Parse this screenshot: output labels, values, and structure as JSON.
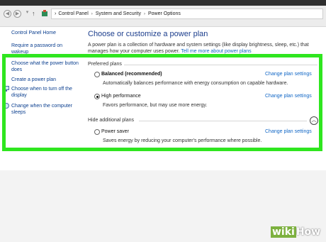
{
  "address_bar": {
    "crumbs": [
      "Control Panel",
      "System and Security",
      "Power Options"
    ],
    "separator": "›"
  },
  "left_nav": {
    "home": "Control Panel Home",
    "items": [
      "Require a password on wakeup",
      "Choose what the power button does",
      "Create a power plan",
      "Choose when to turn off the display",
      "Change when the computer sleeps"
    ]
  },
  "main": {
    "title": "Choose or customize a power plan",
    "intro_text": "A power plan is a collection of hardware and system settings (like display brightness, sleep, etc.) that manages how your computer uses power.",
    "intro_link": "Tell me more about power plans",
    "preferred_label": "Preferred plans",
    "hide_label": "Hide additional plans",
    "plans": [
      {
        "name": "Balanced (recommended)",
        "description": "Automatically balances performance with energy consumption on capable hardware.",
        "change_link": "Change plan settings",
        "selected": false
      },
      {
        "name": "High performance",
        "description": "Favors performance, but may use more energy.",
        "change_link": "Change plan settings",
        "selected": true
      },
      {
        "name": "Power saver",
        "description": "Saves energy by reducing your computer's performance where possible.",
        "change_link": "Change plan settings",
        "selected": false
      }
    ]
  },
  "watermark": {
    "wiki": "wiki",
    "how": "How"
  },
  "colors": {
    "highlight": "#2fe61f",
    "link": "#1167c6",
    "title": "#1b3d8c"
  },
  "icons": [
    "back-icon",
    "forward-icon",
    "up-arrow-icon",
    "control-panel-icon",
    "shield-icon",
    "collapse-chevron-icon"
  ]
}
